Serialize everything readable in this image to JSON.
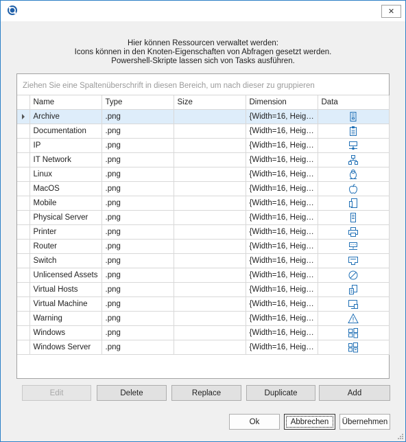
{
  "dialog": {
    "close_glyph": "✕",
    "intro_lines": [
      "Hier können Ressourcen verwaltet werden:",
      "Icons können in den Knoten-Eigenschaften von Abfragen gesetzt werden.",
      "Powershell-Skripte lassen sich von Tasks ausführen."
    ]
  },
  "grid": {
    "group_hint": "Ziehen Sie eine Spaltenüberschrift in diesen Bereich, um nach dieser zu gruppieren",
    "columns": [
      "Name",
      "Type",
      "Size",
      "Dimension",
      "Data"
    ],
    "rows": [
      {
        "name": "Archive",
        "type": ".png",
        "size": "",
        "dimension": "{Width=16, Heig…",
        "icon": "archive-icon",
        "selected": true
      },
      {
        "name": "Documentation",
        "type": ".png",
        "size": "",
        "dimension": "{Width=16, Heig…",
        "icon": "clipboard-icon"
      },
      {
        "name": "IP",
        "type": ".png",
        "size": "",
        "dimension": "{Width=16, Heig…",
        "icon": "ip-network-icon"
      },
      {
        "name": "IT Network",
        "type": ".png",
        "size": "",
        "dimension": "{Width=16, Heig…",
        "icon": "network-tree-icon"
      },
      {
        "name": "Linux",
        "type": ".png",
        "size": "",
        "dimension": "{Width=16, Heig…",
        "icon": "linux-icon"
      },
      {
        "name": "MacOS",
        "type": ".png",
        "size": "",
        "dimension": "{Width=16, Heig…",
        "icon": "apple-icon"
      },
      {
        "name": "Mobile",
        "type": ".png",
        "size": "",
        "dimension": "{Width=16, Heig…",
        "icon": "mobile-icon"
      },
      {
        "name": "Physical Server",
        "type": ".png",
        "size": "",
        "dimension": "{Width=16, Heig…",
        "icon": "server-icon"
      },
      {
        "name": "Printer",
        "type": ".png",
        "size": "",
        "dimension": "{Width=16, Heig…",
        "icon": "printer-icon"
      },
      {
        "name": "Router",
        "type": ".png",
        "size": "",
        "dimension": "{Width=16, Heig…",
        "icon": "router-icon"
      },
      {
        "name": "Switch",
        "type": ".png",
        "size": "",
        "dimension": "{Width=16, Heig…",
        "icon": "switch-icon"
      },
      {
        "name": "Unlicensed Assets",
        "type": ".png",
        "size": "",
        "dimension": "{Width=16, Heig…",
        "icon": "prohibited-icon"
      },
      {
        "name": "Virtual Hosts",
        "type": ".png",
        "size": "",
        "dimension": "{Width=16, Heig…",
        "icon": "virtual-hosts-icon"
      },
      {
        "name": "Virtual Machine",
        "type": ".png",
        "size": "",
        "dimension": "{Width=16, Heig…",
        "icon": "virtual-machine-icon"
      },
      {
        "name": "Warning",
        "type": ".png",
        "size": "",
        "dimension": "{Width=16, Heig…",
        "icon": "warning-icon"
      },
      {
        "name": "Windows",
        "type": ".png",
        "size": "",
        "dimension": "{Width=16, Heig…",
        "icon": "windows-icon"
      },
      {
        "name": "Windows Server",
        "type": ".png",
        "size": "",
        "dimension": "{Width=16, Heig…",
        "icon": "windows-server-icon"
      }
    ]
  },
  "actions": {
    "edit": "Edit",
    "delete": "Delete",
    "replace": "Replace",
    "duplicate": "Duplicate",
    "add": "Add"
  },
  "footer": {
    "ok": "Ok",
    "cancel": "Abbrechen",
    "apply": "Übernehmen"
  },
  "colors": {
    "accent": "#2b7fc6",
    "icon": "#1f6fb5",
    "selected_row": "#deedfa"
  }
}
